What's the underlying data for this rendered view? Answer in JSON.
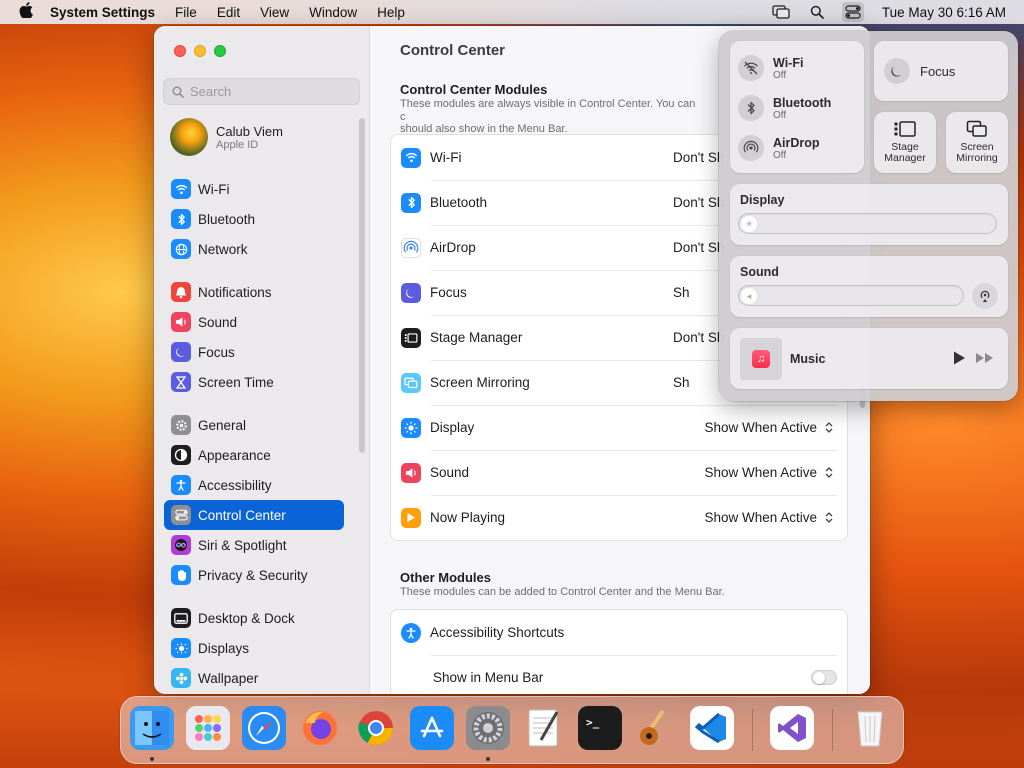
{
  "menubar": {
    "app_name": "System Settings",
    "menus": [
      "File",
      "Edit",
      "View",
      "Window",
      "Help"
    ],
    "clock": "Tue May 30  6:16 AM"
  },
  "sidebar": {
    "search_placeholder": "Search",
    "user": {
      "name": "Calub Viem",
      "subtitle": "Apple ID"
    },
    "groups": [
      [
        {
          "label": "Wi-Fi",
          "icon": "wifi-icon",
          "color": "#1a8cff"
        },
        {
          "label": "Bluetooth",
          "icon": "bluetooth-icon",
          "color": "#1a8cff"
        },
        {
          "label": "Network",
          "icon": "globe-icon",
          "color": "#1a8cff"
        }
      ],
      [
        {
          "label": "Notifications",
          "icon": "bell-icon",
          "color": "#f0443c"
        },
        {
          "label": "Sound",
          "icon": "speaker-icon",
          "color": "#f0445e"
        },
        {
          "label": "Focus",
          "icon": "moon-icon",
          "color": "#5c5ce0"
        },
        {
          "label": "Screen Time",
          "icon": "hourglass-icon",
          "color": "#5c5ce0"
        }
      ],
      [
        {
          "label": "General",
          "icon": "gear-icon",
          "color": "#8e8e93"
        },
        {
          "label": "Appearance",
          "icon": "appearance-icon",
          "color": "#1d1d1f"
        },
        {
          "label": "Accessibility",
          "icon": "accessibility-icon",
          "color": "#1a8cff"
        },
        {
          "label": "Control Center",
          "icon": "control-center-icon",
          "color": "#8e8e93",
          "selected": true
        },
        {
          "label": "Siri & Spotlight",
          "icon": "siri-icon",
          "color": "#b03cd6"
        },
        {
          "label": "Privacy & Security",
          "icon": "hand-icon",
          "color": "#1a8cff"
        }
      ],
      [
        {
          "label": "Desktop & Dock",
          "icon": "dock-icon",
          "color": "#1d1d1f"
        },
        {
          "label": "Displays",
          "icon": "display-icon",
          "color": "#1a8cff"
        },
        {
          "label": "Wallpaper",
          "icon": "wallpaper-icon",
          "color": "#38b6f0"
        }
      ]
    ]
  },
  "main": {
    "title": "Control Center",
    "modules": {
      "title": "Control Center Modules",
      "desc": "These modules are always visible in Control Center. You can c\nshould also show in the Menu Bar.",
      "rows": [
        {
          "label": "Wi-Fi",
          "value": "Don't Sh",
          "icon": "wifi-icon",
          "color": "#1a8cff",
          "stepper": false
        },
        {
          "label": "Bluetooth",
          "value": "Don't Sh",
          "icon": "bluetooth-icon",
          "color": "#1a8cff",
          "stepper": false
        },
        {
          "label": "AirDrop",
          "value": "Don't Sh",
          "icon": "airdrop-icon",
          "color": "#ffffff",
          "stepper": false
        },
        {
          "label": "Focus",
          "value": "Sh",
          "icon": "moon-icon",
          "color": "#5c5ce0",
          "stepper": false
        },
        {
          "label": "Stage Manager",
          "value": "Don't Sh",
          "icon": "stage-manager-icon",
          "color": "#1d1d1f",
          "stepper": false
        },
        {
          "label": "Screen Mirroring",
          "value": "Sh",
          "icon": "screen-mirroring-icon",
          "color": "#5ac8fa",
          "stepper": false
        },
        {
          "label": "Display",
          "value": "Show When Active",
          "icon": "sun-icon",
          "color": "#1a8cff",
          "stepper": true
        },
        {
          "label": "Sound",
          "value": "Show When Active",
          "icon": "speaker-icon",
          "color": "#f0445e",
          "stepper": true
        },
        {
          "label": "Now Playing",
          "value": "Show When Active",
          "icon": "play-icon",
          "color": "#ff9f0a",
          "stepper": true
        }
      ]
    },
    "other": {
      "title": "Other Modules",
      "desc": "These modules can be added to Control Center and the Menu Bar.",
      "rows": [
        {
          "label": "Accessibility Shortcuts",
          "icon": "accessibility-icon",
          "color": "#1a8cff"
        },
        {
          "label": "Show in Menu Bar",
          "toggle": false
        }
      ]
    }
  },
  "control_center": {
    "connectivity": [
      {
        "name": "Wi-Fi",
        "state": "Off",
        "icon": "wifi-off-icon"
      },
      {
        "name": "Bluetooth",
        "state": "Off",
        "icon": "bluetooth-icon"
      },
      {
        "name": "AirDrop",
        "state": "Off",
        "icon": "airdrop-icon"
      }
    ],
    "focus_label": "Focus",
    "stage_manager_label": "Stage\nManager",
    "screen_mirroring_label": "Screen\nMirroring",
    "display_label": "Display",
    "sound_label": "Sound",
    "music_label": "Music"
  },
  "dock": {
    "apps": [
      {
        "name": "Finder",
        "icon": "finder-icon",
        "color": "#3a9af0",
        "running": true
      },
      {
        "name": "Launchpad",
        "icon": "launchpad-icon",
        "color": "#e8e8ee",
        "running": false
      },
      {
        "name": "Safari",
        "icon": "safari-icon",
        "color": "#2a8cf2",
        "running": false
      },
      {
        "name": "Firefox",
        "icon": "firefox-icon",
        "color": "#ff7139",
        "running": false
      },
      {
        "name": "Chrome",
        "icon": "chrome-icon",
        "color": "#ffffff",
        "running": false
      },
      {
        "name": "App Store",
        "icon": "app-store-icon",
        "color": "#1b8cf5",
        "running": false
      },
      {
        "name": "System Settings",
        "icon": "system-settings-icon",
        "color": "#8a8a8f",
        "running": true
      },
      {
        "name": "TextEdit",
        "icon": "textedit-icon",
        "color": "#f5f5f5",
        "running": false
      },
      {
        "name": "Terminal",
        "icon": "terminal-icon",
        "color": "#1c1c1e",
        "running": false
      },
      {
        "name": "GarageBand",
        "icon": "garageband-icon",
        "color": "#5a3a1e",
        "running": false
      },
      {
        "name": "VS Code",
        "icon": "vscode-icon",
        "color": "#ffffff",
        "running": false
      },
      {
        "name": "Visual Studio",
        "icon": "visual-studio-icon",
        "color": "#ffffff",
        "running": false
      },
      {
        "name": "Trash",
        "icon": "trash-icon",
        "color": "#e6e6ea",
        "running": false
      }
    ]
  }
}
